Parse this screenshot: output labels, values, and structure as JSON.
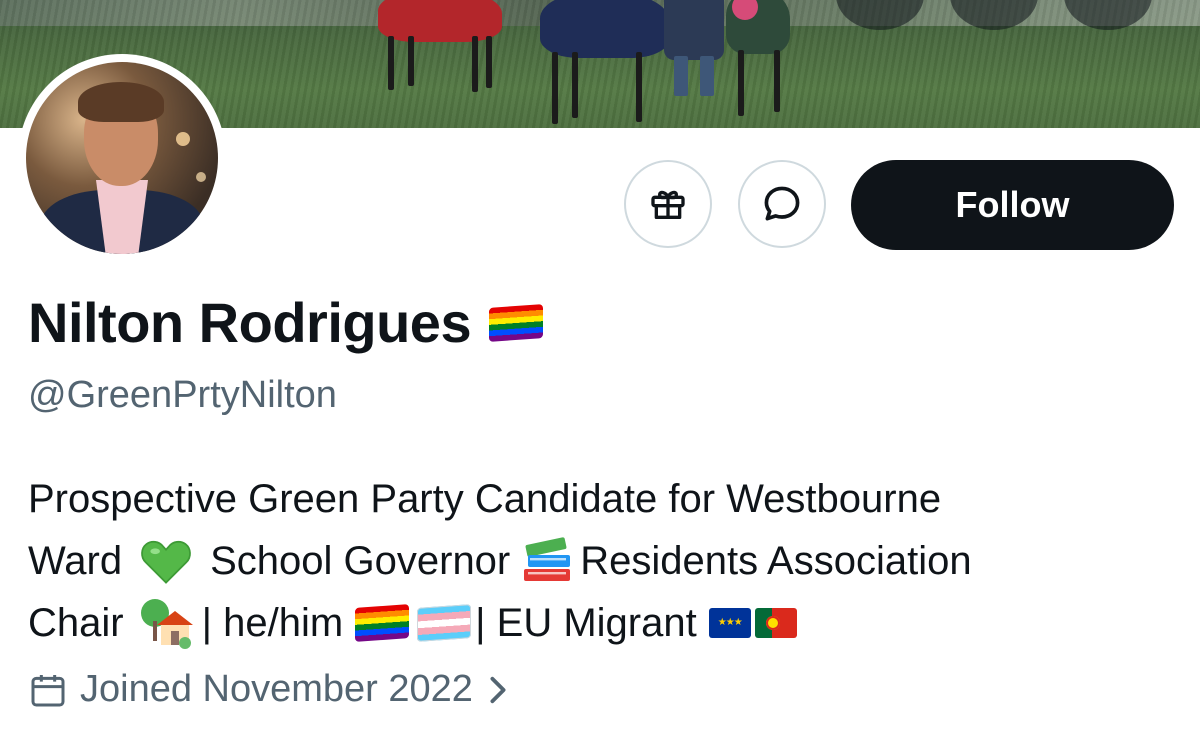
{
  "profile": {
    "name": "Nilton Rodrigues",
    "handle": "@GreenPrtyNilton",
    "joined": "Joined November 2022"
  },
  "actions": {
    "gift_icon": "gift-icon",
    "message_icon": "message-icon",
    "follow_label": "Follow"
  },
  "bio": {
    "line1": "Prospective Green Party Candidate for Westbourne",
    "line2_a": "Ward",
    "line2_b": "School Governor",
    "line2_c": "Residents Association",
    "line3_a": "Chair",
    "line3_b": "| he/him",
    "line3_c": "| EU Migrant"
  },
  "emoji": {
    "name_flag": "rainbow-flag",
    "heart": "green-heart",
    "books": "books",
    "house": "house-with-garden",
    "pride": "rainbow-flag",
    "trans": "transgender-flag",
    "eu": "eu-flag",
    "portugal": "portugal-flag"
  },
  "colors": {
    "text_primary": "#0f1419",
    "text_secondary": "#536471",
    "follow_bg": "#0f1419",
    "border": "#cfd9de"
  }
}
